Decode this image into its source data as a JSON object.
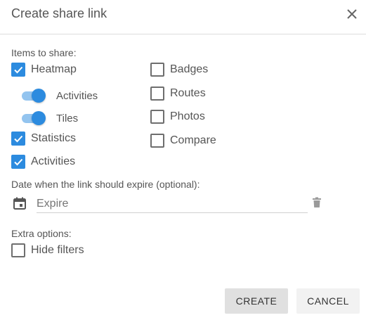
{
  "dialog": {
    "title": "Create share link",
    "close_icon": "close-icon"
  },
  "items_section": {
    "label": "Items to share:",
    "left_items": [
      {
        "label": "Heatmap",
        "checked": true
      },
      {
        "label": "Statistics",
        "checked": true
      },
      {
        "label": "Activities",
        "checked": true
      }
    ],
    "heatmap_toggles": [
      {
        "label": "Activities",
        "on": true
      },
      {
        "label": "Tiles",
        "on": true
      }
    ],
    "right_items": [
      {
        "label": "Badges",
        "checked": false
      },
      {
        "label": "Routes",
        "checked": false
      },
      {
        "label": "Photos",
        "checked": false
      },
      {
        "label": "Compare",
        "checked": false
      }
    ]
  },
  "expiry": {
    "label": "Date when the link should expire (optional):",
    "placeholder": "Expire",
    "value": "",
    "calendar_icon": "calendar-icon",
    "clear_icon": "trash-icon"
  },
  "extra": {
    "label": "Extra options:",
    "hide_filters": {
      "label": "Hide filters",
      "checked": false
    }
  },
  "actions": {
    "create_label": "CREATE",
    "cancel_label": "CANCEL"
  },
  "colors": {
    "accent": "#2c8bdf",
    "toggle_track": "#93c4ef"
  }
}
